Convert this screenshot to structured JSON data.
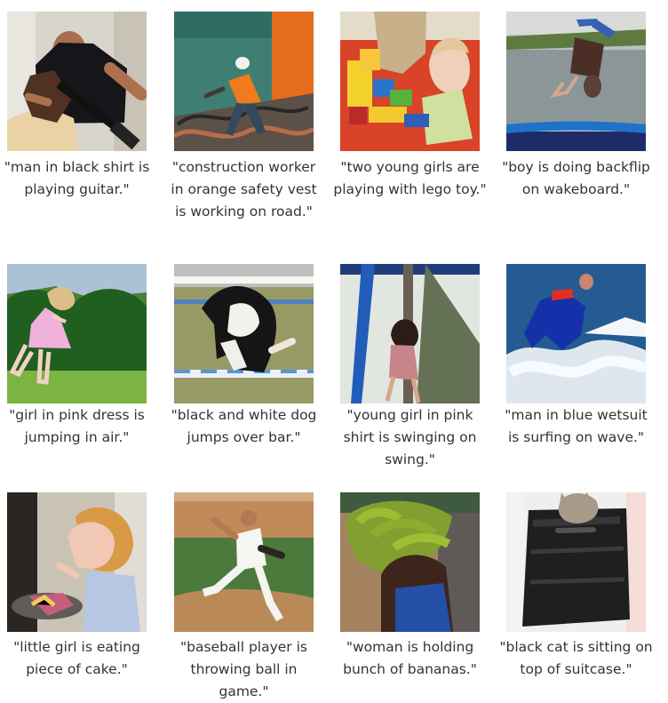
{
  "gallery": {
    "items": [
      {
        "caption": "\"man in black shirt is playing guitar.\""
      },
      {
        "caption": "\"construction worker in orange safety vest is working on road.\""
      },
      {
        "caption": "\"two young girls are playing with lego toy.\""
      },
      {
        "caption": "\"boy is doing backflip on wakeboard.\""
      },
      {
        "caption": "\"girl in pink dress is jumping in air.\""
      },
      {
        "caption": "\"black and white dog jumps over bar.\""
      },
      {
        "caption": "\"young girl in pink shirt is swinging on swing.\""
      },
      {
        "caption": "\"man in blue wetsuit is surfing on wave.\""
      },
      {
        "caption": "\"little girl is eating piece of cake.\""
      },
      {
        "caption": "\"baseball player is throwing ball in game.\""
      },
      {
        "caption": "\"woman is holding bunch of bananas.\""
      },
      {
        "caption": "\"black cat is sitting on top of suitcase.\""
      }
    ]
  }
}
